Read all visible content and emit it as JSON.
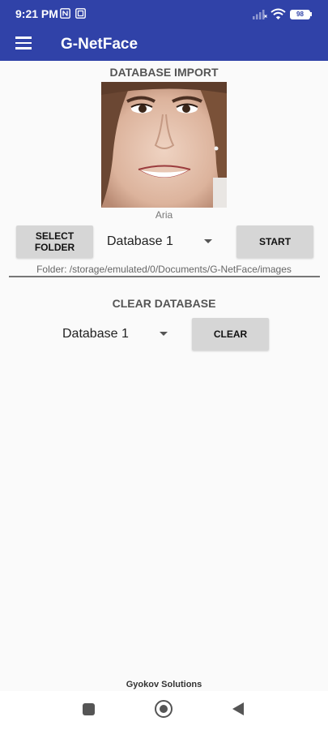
{
  "status_bar": {
    "time": "9:21 PM",
    "battery": "98",
    "icons": [
      "nfc-icon",
      "notification-icon",
      "signal-icon",
      "wifi-icon",
      "battery-icon"
    ]
  },
  "app_bar": {
    "title": "G-NetFace",
    "menu_icon": "hamburger-menu-icon",
    "color": "#3042a8"
  },
  "import_section": {
    "title": "DATABASE IMPORT",
    "face_caption": "Aria",
    "select_folder_label": "SELECT\nFOLDER",
    "database_selected": "Database 1",
    "start_label": "START",
    "folder_path": "Folder: /storage/emulated/0/Documents/G-NetFace/images"
  },
  "clear_section": {
    "title": "CLEAR DATABASE",
    "database_selected": "Database 1",
    "clear_label": "CLEAR"
  },
  "footer": {
    "text": "Gyokov Solutions"
  },
  "nav_bar": {
    "icons": [
      "recent-apps-icon",
      "home-icon",
      "back-icon"
    ]
  }
}
